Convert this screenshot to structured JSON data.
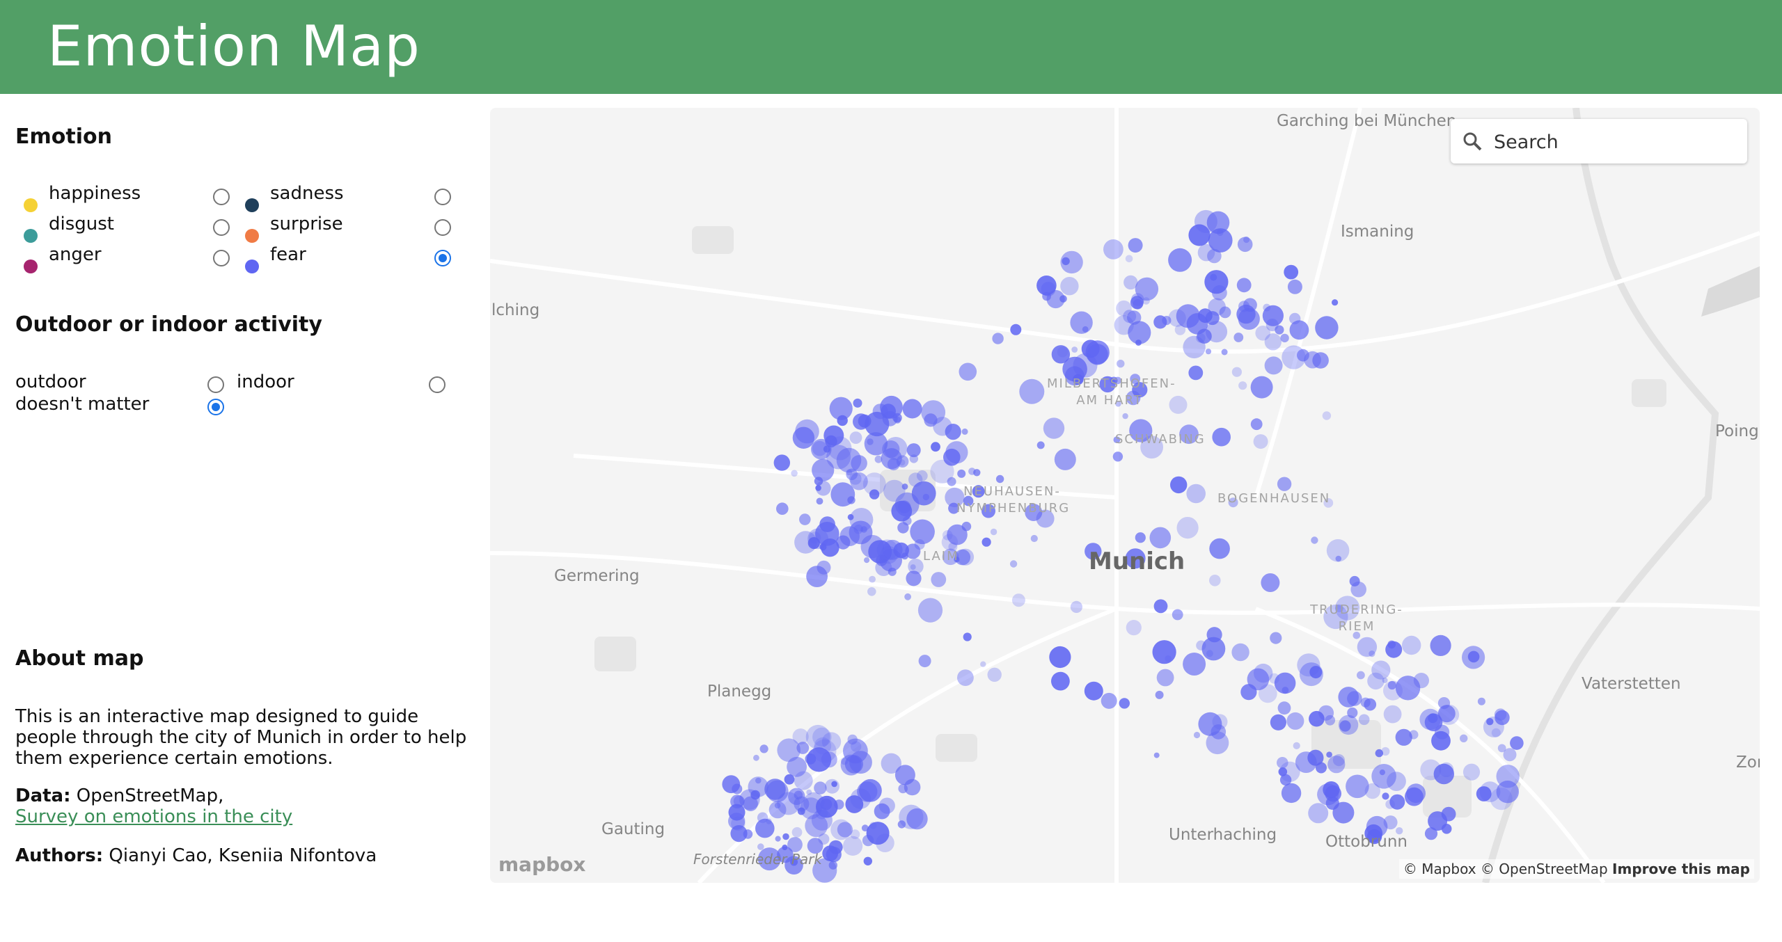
{
  "header": {
    "title": "Emotion Map"
  },
  "emotion": {
    "title": "Emotion",
    "options": [
      {
        "label": "happiness",
        "color": "#f5d135",
        "checked": false
      },
      {
        "label": "sadness",
        "color": "#1f3f5b",
        "checked": false
      },
      {
        "label": "disgust",
        "color": "#3c9c9a",
        "checked": false
      },
      {
        "label": "surprise",
        "color": "#f07b45",
        "checked": false
      },
      {
        "label": "anger",
        "color": "#a6246e",
        "checked": false
      },
      {
        "label": "fear",
        "color": "#5f66f2",
        "checked": true
      }
    ]
  },
  "activity": {
    "title": "Outdoor or indoor activity",
    "options": [
      {
        "label": "outdoor",
        "checked": false
      },
      {
        "label": "indoor",
        "checked": false
      },
      {
        "label": "doesn't matter",
        "checked": true
      }
    ]
  },
  "about": {
    "title": "About map",
    "description": "This is an interactive map designed to guide people through the city of Munich in order to help them experience certain emotions.",
    "data_label": "Data:",
    "data_source": "OpenStreetMap,",
    "survey_link": "Survey on emotions in the city",
    "authors_label": "Authors:",
    "authors": "Qianyi Cao, Kseniia Nifontova"
  },
  "map": {
    "search_placeholder": "Search",
    "city": "Munich",
    "places": [
      "Garching bei München",
      "Ismaning",
      "lching",
      "Poing",
      "Germering",
      "Vaterstetten",
      "Planegg",
      "Zor",
      "Gauting",
      "Unterhaching",
      "Ottobrunn",
      "Forstenrieder Park"
    ],
    "districts": [
      "MILBERTSHOFEN-AM HART",
      "SCHWABING",
      "NEUHAUSEN-NYMPHENBURG",
      "BOGENHAUSEN",
      "LAIM",
      "TRUDERING-RIEM"
    ],
    "attribution": "© Mapbox © OpenStreetMap",
    "improve": "Improve this map",
    "logo": "mapbox",
    "heat_color": "#5f66f2"
  }
}
